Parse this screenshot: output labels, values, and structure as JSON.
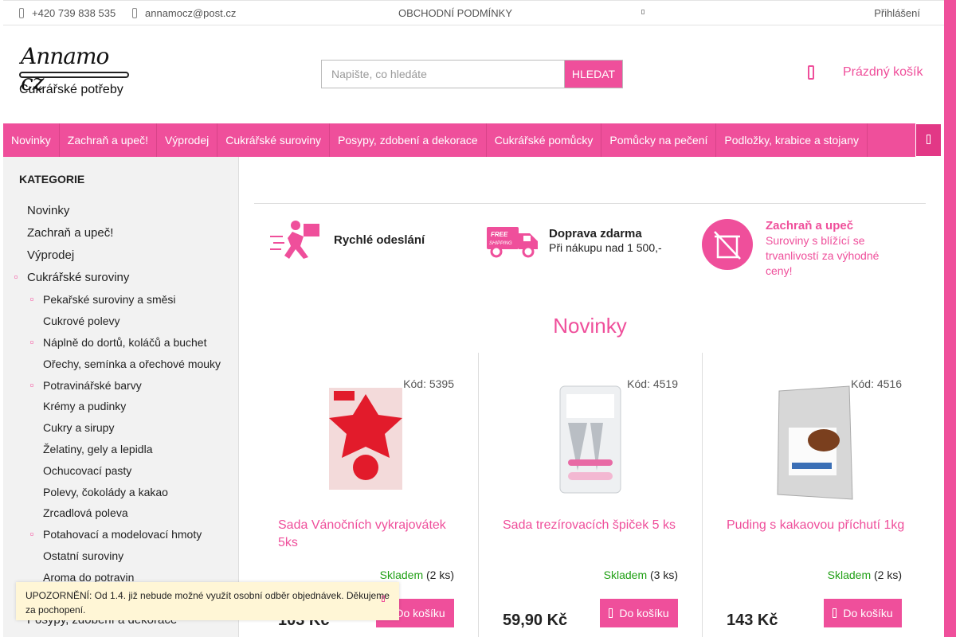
{
  "topbar": {
    "phone": "+420 739 838 535",
    "email": "annamocz@post.cz",
    "terms": "OBCHODNÍ PODMÍNKY",
    "login": "Přihlášení"
  },
  "logo": {
    "brand": "Annamo cz",
    "tagline": "Cukrářské potřeby"
  },
  "search": {
    "placeholder": "Napište, co hledáte",
    "button": "HLEDAT"
  },
  "cart": {
    "label": "Prázdný košík"
  },
  "nav": {
    "items": [
      "Novinky",
      "Zachraň a upeč!",
      "Výprodej",
      "Cukrářské suroviny",
      "Posypy, zdobení a dekorace",
      "Cukrářské pomůcky",
      "Pomůcky na pečení",
      "Podložky, krabice a stojany"
    ]
  },
  "sidebar": {
    "heading": "KATEGORIE",
    "top": [
      "Novinky",
      "Zachraň a upeč!",
      "Výprodej",
      "Cukrářské suroviny"
    ],
    "sub": [
      "Pekařské suroviny a směsi",
      "Cukrové polevy",
      "Náplně do dortů, koláčů a buchet",
      "Ořechy, semínka a ořechové mouky",
      "Potravinářské barvy",
      "Krémy a pudinky",
      "Cukry a sirupy",
      "Želatiny, gely a lepidla",
      "Ochucovací pasty",
      "Polevy, čokolády a kakao",
      "Zrcadlová poleva",
      "Potahovací a modelovací hmoty",
      "Ostatní suroviny",
      "Aroma do potravin"
    ],
    "last": "Posypy, zdobení a dekorace"
  },
  "features": {
    "f1": {
      "title": "Rychlé odeslání"
    },
    "f2": {
      "title": "Doprava zdarma",
      "text": "Při nákupu nad 1 500,-"
    },
    "f3": {
      "title": "Zachraň a upeč",
      "text": "Suroviny s blížící se trvanlivostí za výhodné ceny!"
    }
  },
  "section": {
    "title": "Novinky"
  },
  "products": [
    {
      "code": "Kód: 5395",
      "title": "Sada Vánočních vykrajovátek 5ks",
      "stock": "Skladem",
      "qty": "(2 ks)",
      "price": "103 Kč",
      "button": "Do košíku"
    },
    {
      "code": "Kód: 4519",
      "title": "Sada trezírovacích špiček 5 ks",
      "stock": "Skladem",
      "qty": "(3 ks)",
      "price": "59,90 Kč",
      "button": "Do košíku"
    },
    {
      "code": "Kód: 4516",
      "title": "Puding s kakaovou příchutí 1kg",
      "stock": "Skladem",
      "qty": "(2 ks)",
      "price": "143 Kč",
      "button": "Do košíku"
    }
  ],
  "notice": {
    "text": "UPOZORNĚNÍ: Od 1.4. již nebude možné využít osobní odběr objednávek. Děkujeme za pochopení."
  },
  "colors": {
    "accent": "#ef4f9b",
    "stock": "#21a016"
  }
}
